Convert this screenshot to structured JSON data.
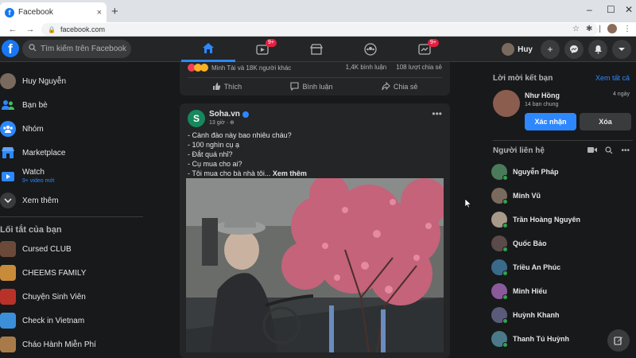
{
  "browser": {
    "tab_title": "Facebook",
    "tab_close": "×",
    "new_tab": "+",
    "url": "facebook.com",
    "back": "←",
    "forward": "→",
    "reload": "C",
    "minimize": "–",
    "maximize": "☐",
    "close": "✕"
  },
  "header": {
    "logo": "f",
    "search_placeholder": "Tìm kiếm trên Facebook",
    "video_badge": "9+",
    "gaming_badge": "9+",
    "user_name": "Huy"
  },
  "left_sidebar": {
    "items": [
      {
        "label": "Huy Nguyễn",
        "icon": "avatar"
      },
      {
        "label": "Bạn bè",
        "icon": "friends-icon"
      },
      {
        "label": "Nhóm",
        "icon": "groups-icon"
      },
      {
        "label": "Marketplace",
        "icon": "marketplace-icon"
      },
      {
        "label": "Watch",
        "icon": "watch-icon",
        "sub": "9+ video mới"
      },
      {
        "label": "Xem thêm",
        "icon": "chevron-down-icon"
      }
    ],
    "shortcuts_title": "Lối tắt của bạn",
    "shortcuts": [
      {
        "label": "Cursed CLUB",
        "color": "#6b4a3a"
      },
      {
        "label": "CHEEMS FAMILY",
        "color": "#c88b3a"
      },
      {
        "label": "Chuyện Sinh Viên",
        "color": "#b8322a"
      },
      {
        "label": "Check in Vietnam",
        "color": "#3a8fd8"
      },
      {
        "label": "Cháo Hành Miễn Phí",
        "color": "#a87a4a"
      }
    ]
  },
  "prev_post": {
    "reactors": "Minh Tài và 18K người khác",
    "comments": "1,4K bình luận",
    "shares": "108 lượt chia sẻ",
    "like": "Thích",
    "comment": "Bình luận",
    "share": "Chia sẻ"
  },
  "post": {
    "avatar_letter": "S",
    "author": "Soha.vn",
    "time": "13 giờ · ⊕",
    "lines": [
      "- Cành đào này bao nhiêu cháu?",
      "- 100 nghìn cụ ạ",
      "- Đắt quá nhỉ?",
      "- Cụ mua cho ai?",
      "- Tôi mua cho bà nhà tôi..."
    ],
    "see_more": "Xem thêm",
    "more": "•••"
  },
  "right_sidebar": {
    "friend_requests_title": "Lời mời kết bạn",
    "see_all": "Xem tất cả",
    "request": {
      "name": "Như Hồng",
      "mutual": "14 bạn chung",
      "time": "4 ngày",
      "accept": "Xác nhận",
      "delete": "Xóa"
    },
    "contacts_title": "Người liên hệ",
    "contacts": [
      {
        "name": "Nguyễn Pháp",
        "color": "#4a7a5a"
      },
      {
        "name": "Minh Vũ",
        "color": "#7a6a5e"
      },
      {
        "name": "Trần Hoàng Nguyên",
        "color": "#a89a8a"
      },
      {
        "name": "Quốc Bảo",
        "color": "#5a4a4a"
      },
      {
        "name": "Triều An Phúc",
        "color": "#3a6a8a"
      },
      {
        "name": "Minh Hiếu",
        "color": "#8a5a9a"
      },
      {
        "name": "Huỳnh Khanh",
        "color": "#5a5a7a"
      },
      {
        "name": "Thanh Tú Huỳnh",
        "color": "#4a7a8a"
      }
    ]
  }
}
